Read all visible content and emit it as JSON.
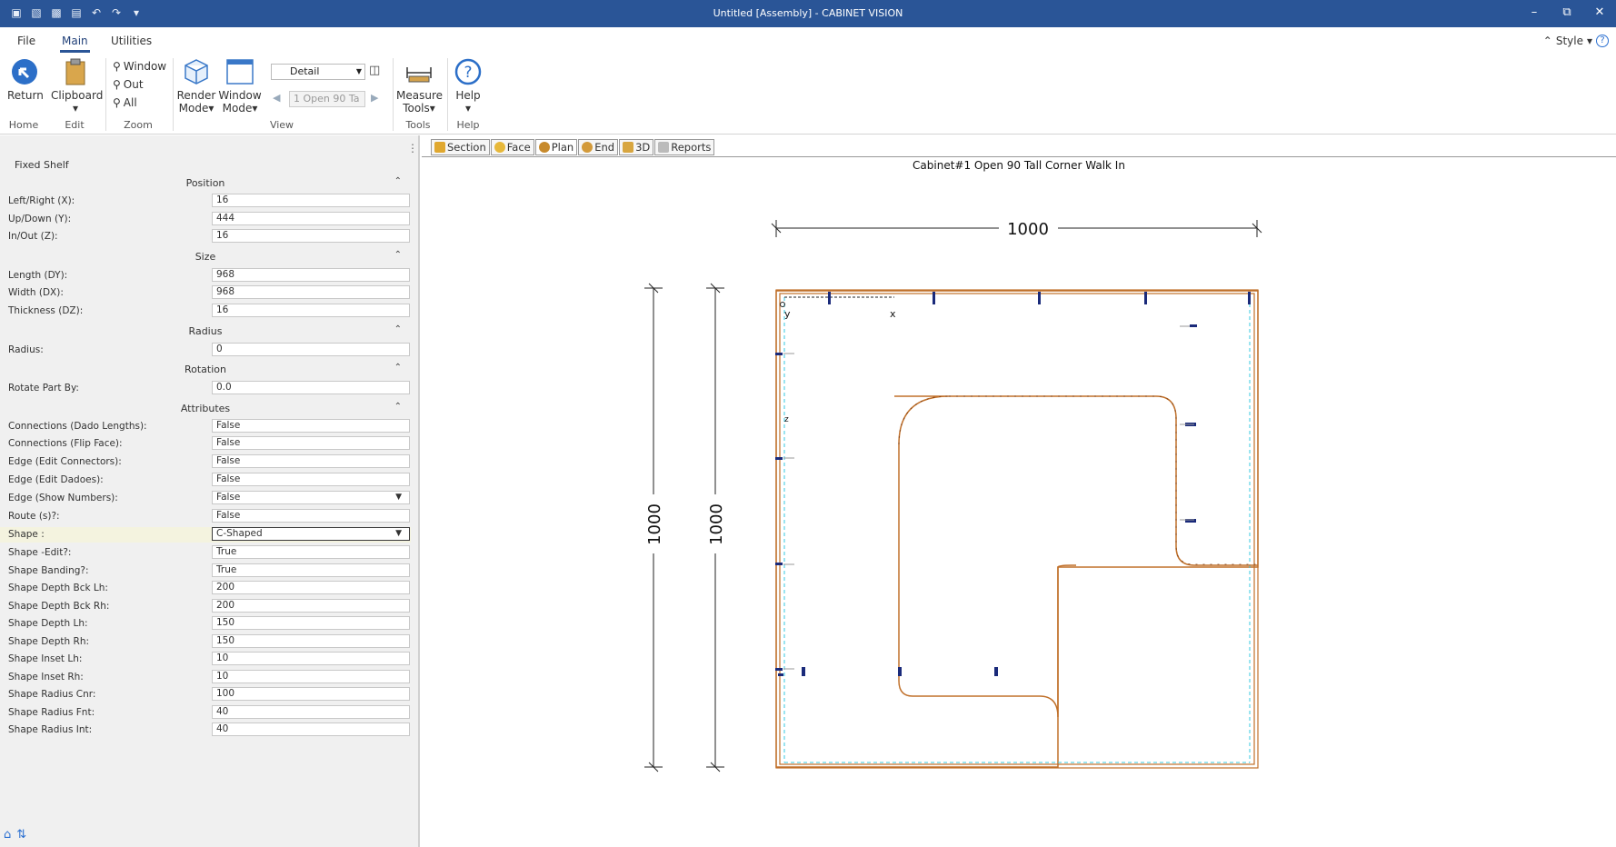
{
  "window": {
    "title": "Untitled [Assembly] - CABINET VISION",
    "minimize": "–",
    "restore": "⧉",
    "close": "✕"
  },
  "ribbon": {
    "tabs": [
      "File",
      "Main",
      "Utilities"
    ],
    "active_tab": "Main",
    "style_label": "Style",
    "buttons": {
      "return": "Return",
      "clipboard": "Clipboard",
      "zoom_window": "Window",
      "zoom_out": "Out",
      "zoom_all": "All",
      "render_mode_1": "Render",
      "render_mode_2": "Mode",
      "window_mode_1": "Window",
      "window_mode_2": "Mode",
      "measure_tools_1": "Measure",
      "measure_tools_2": "Tools",
      "help": "Help"
    },
    "view_select": "Detail",
    "cabinet_select": "1 Open 90 Ta",
    "groups": {
      "home": "Home",
      "edit": "Edit",
      "zoom": "Zoom",
      "view": "View",
      "tools": "Tools",
      "help": "Help"
    }
  },
  "panel": {
    "title": "Fixed Shelf",
    "sections": {
      "position": "Position",
      "size": "Size",
      "radius": "Radius",
      "rotation": "Rotation",
      "attributes": "Attributes"
    },
    "position": [
      {
        "label": "Left/Right (X):",
        "value": "16"
      },
      {
        "label": "Up/Down (Y):",
        "value": "444"
      },
      {
        "label": "In/Out (Z):",
        "value": "16"
      }
    ],
    "size": [
      {
        "label": "Length (DY):",
        "value": "968"
      },
      {
        "label": "Width (DX):",
        "value": "968"
      },
      {
        "label": "Thickness (DZ):",
        "value": "16"
      }
    ],
    "radius": [
      {
        "label": "Radius:",
        "value": "0"
      }
    ],
    "rotation": [
      {
        "label": "Rotate Part By:",
        "value": "0.0"
      }
    ],
    "attributes": [
      {
        "label": "Connections (Dado Lengths):",
        "value": "False"
      },
      {
        "label": "Connections (Flip Face):",
        "value": "False"
      },
      {
        "label": "Edge (Edit Connectors):",
        "value": "False"
      },
      {
        "label": "Edge (Edit Dadoes):",
        "value": "False"
      },
      {
        "label": "Edge (Show Numbers):",
        "value": "False"
      },
      {
        "label": "Route (s)?:",
        "value": "False"
      },
      {
        "label": "Shape :",
        "value": "C-Shaped"
      },
      {
        "label": "Shape -Edit?:",
        "value": "True"
      },
      {
        "label": "Shape Banding?:",
        "value": "True"
      },
      {
        "label": "Shape Depth Bck Lh:",
        "value": "200"
      },
      {
        "label": "Shape Depth Bck Rh:",
        "value": "200"
      },
      {
        "label": "Shape Depth Lh:",
        "value": "150"
      },
      {
        "label": "Shape Depth Rh:",
        "value": "150"
      },
      {
        "label": "Shape Inset Lh:",
        "value": "10"
      },
      {
        "label": "Shape Inset Rh:",
        "value": "10"
      },
      {
        "label": "Shape Radius Cnr:",
        "value": "100"
      },
      {
        "label": "Shape Radius Fnt:",
        "value": "40"
      },
      {
        "label": "Shape Radius Int:",
        "value": "40"
      }
    ]
  },
  "view": {
    "tabs": [
      "Section",
      "Face",
      "Plan",
      "End",
      "3D",
      "Reports"
    ],
    "active_tab": "Plan",
    "cabinet_title": "Cabinet#1 Open 90 Tall Corner Walk In",
    "dim_width": "1000",
    "dim_height_1": "1000",
    "dim_height_2": "1000",
    "axis_y": "y",
    "axis_x": "x",
    "axis_z": "z"
  },
  "colors": {
    "titlebar": "#2a5597",
    "outline": "#c0702a",
    "hardware": "#1a2a7a",
    "guide": "#35c8e0"
  }
}
